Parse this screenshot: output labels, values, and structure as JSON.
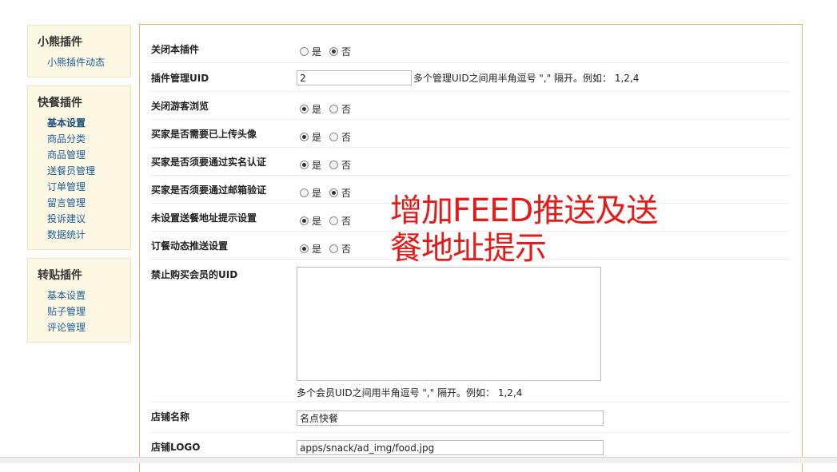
{
  "sidebar": {
    "blocks": [
      {
        "title": "小熊插件",
        "items": [
          "小熊插件动态"
        ]
      },
      {
        "title": "快餐插件",
        "items": [
          "基本设置",
          "商品分类",
          "商品管理",
          "送餐员管理",
          "订单管理",
          "留言管理",
          "投诉建议",
          "数据统计"
        ]
      },
      {
        "title": "转贴插件",
        "items": [
          "基本设置",
          "贴子管理",
          "评论管理"
        ]
      }
    ]
  },
  "form": {
    "close_plugin": {
      "label": "关闭本插件",
      "yes": "是",
      "no": "否",
      "selected": "no"
    },
    "admin_uid": {
      "label": "插件管理UID",
      "value": "2",
      "hint": "多个管理UID之间用半角逗号 \",\" 隔开。例如： 1,2,4"
    },
    "close_guest": {
      "label": "关闭游客浏览",
      "yes": "是",
      "no": "否",
      "selected": "yes"
    },
    "need_avatar": {
      "label": "买家是否需要已上传头像",
      "yes": "是",
      "no": "否",
      "selected": "yes"
    },
    "need_realname": {
      "label": "买家是否须要通过实名认证",
      "yes": "是",
      "no": "否",
      "selected": "yes"
    },
    "need_email": {
      "label": "买家是否须要通过邮箱验证",
      "yes": "是",
      "no": "否",
      "selected": "no"
    },
    "addr_tip": {
      "label": "未设置送餐地址提示设置",
      "yes": "是",
      "no": "否",
      "selected": "yes"
    },
    "feed_push": {
      "label": "订餐动态推送设置",
      "yes": "是",
      "no": "否",
      "selected": "yes"
    },
    "ban_uid": {
      "label": "禁止购买会员的UID",
      "hint": "多个会员UID之间用半角逗号 \",\" 隔开。例如： 1,2,4"
    },
    "shop_name": {
      "label": "店铺名称",
      "value": "名点快餐"
    },
    "shop_logo": {
      "label": "店铺LOGO",
      "value": "apps/snack/ad_img/food.jpg"
    }
  },
  "annotation": {
    "line1": "增加FEED推送及送",
    "line2": "餐地址提示"
  },
  "colors": {
    "annotation": "#e21b1b",
    "sidebar_bg": "#fcf8e3",
    "main_border": "#e3b76a",
    "link": "#1f5e9a"
  }
}
